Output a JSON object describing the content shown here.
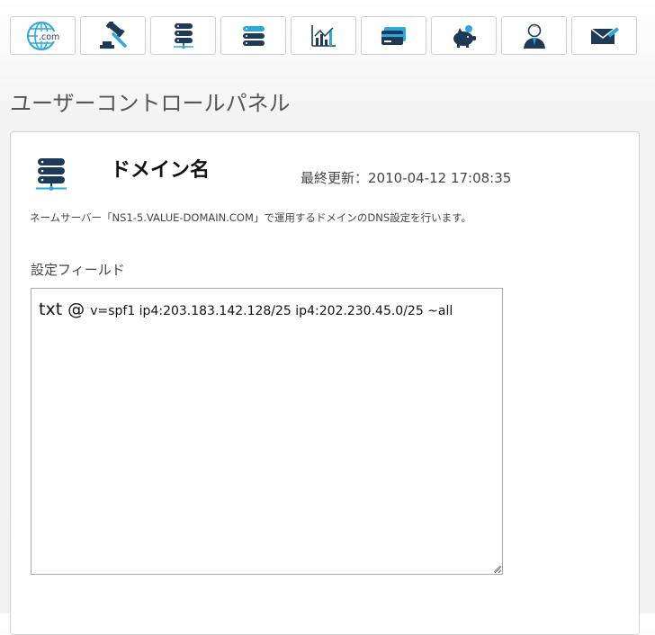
{
  "toolbar": {
    "items": [
      {
        "name": "domain-com",
        "icon": "globe-com-icon",
        "label": ".com"
      },
      {
        "name": "auction",
        "icon": "gavel-icon"
      },
      {
        "name": "server",
        "icon": "server-dark-icon"
      },
      {
        "name": "server-blue",
        "icon": "server-blue-icon"
      },
      {
        "name": "statistics",
        "icon": "bar-chart-icon"
      },
      {
        "name": "payment",
        "icon": "credit-card-icon"
      },
      {
        "name": "points",
        "icon": "piggy-bank-icon"
      },
      {
        "name": "account",
        "icon": "user-icon"
      },
      {
        "name": "mail",
        "icon": "mail-pencil-icon"
      }
    ]
  },
  "page": {
    "title": "ユーザーコントロールパネル"
  },
  "panel": {
    "domain_title": "ドメイン名",
    "last_updated": "最終更新：2010-04-12 17:08:35",
    "description": "ネームサーバー「NS1-5.VALUE-DOMAIN.COM」で運用するドメインのDNS設定を行います。",
    "field_label": "設定フィールド",
    "record": {
      "type": "txt @",
      "value": "v=spf1 ip4:203.183.142.128/25 ip4:202.230.45.0/25 ~all"
    }
  },
  "colors": {
    "navy": "#1f3a57",
    "cyan": "#29a9df",
    "blue": "#1e88e5"
  }
}
